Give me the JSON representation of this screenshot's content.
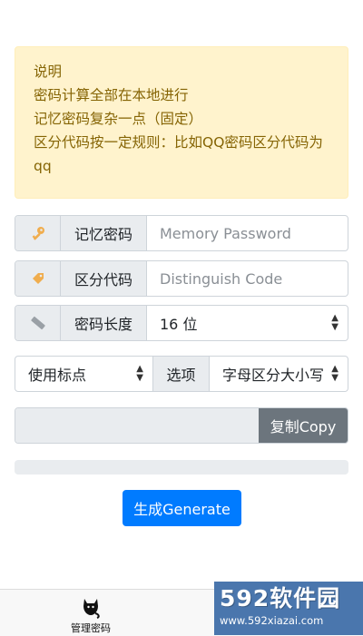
{
  "notice": {
    "title": "说明",
    "lines": [
      "密码计算全部在本地进行",
      "记忆密码复杂一点（固定）",
      "区分代码按一定规则：比如QQ密码区分代码为qq"
    ]
  },
  "memory_password": {
    "label": "记忆密码",
    "placeholder": "Memory Password",
    "icon": "key-icon"
  },
  "distinguish_code": {
    "label": "区分代码",
    "placeholder": "Distinguish Code",
    "icon": "tag-icon"
  },
  "password_length": {
    "label": "密码长度",
    "value": "16 位",
    "icon": "ruler-icon"
  },
  "punctuation": {
    "value": "使用标点"
  },
  "options": {
    "label": "选项",
    "value": "字母区分大小写"
  },
  "copy_button": {
    "label": "复制Copy"
  },
  "generate_button": {
    "label": "生成Generate"
  },
  "tabbar": {
    "manage_label": "管理密码",
    "icon": "cat-icon"
  },
  "watermark": {
    "brand": "592软件园",
    "url": "www.592xiazai.com"
  },
  "colors": {
    "alert_bg": "#fff3cd",
    "alert_text": "#856404",
    "primary": "#007bff",
    "secondary": "#6c757d",
    "addon_bg": "#e9ecef",
    "watermark_bg": "#4a76ad"
  }
}
